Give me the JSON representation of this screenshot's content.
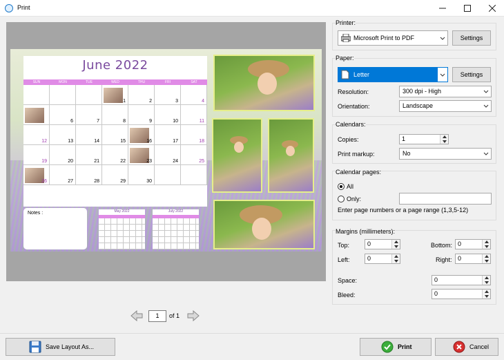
{
  "window": {
    "title": "Print"
  },
  "preview": {
    "calendar_title": "June 2022",
    "weekdays": [
      "SUN",
      "MON",
      "TUE",
      "WED",
      "THU",
      "FRI",
      "SAT"
    ],
    "day_numbers": [
      "1",
      "2",
      "3",
      "4",
      "6",
      "7",
      "8",
      "9",
      "10",
      "11",
      "12",
      "13",
      "14",
      "15",
      "16",
      "17",
      "18",
      "19",
      "20",
      "21",
      "22",
      "23",
      "24",
      "25",
      "26",
      "27",
      "28",
      "29",
      "30"
    ],
    "notes_label": "Notes :",
    "mini_left": "May 2022",
    "mini_right": "July 2022"
  },
  "pager": {
    "current": "1",
    "of_label": "of 1"
  },
  "printer": {
    "group_label": "Printer:",
    "selected": "Microsoft Print to PDF",
    "settings_label": "Settings"
  },
  "paper": {
    "group_label": "Paper:",
    "selected": "Letter",
    "settings_label": "Settings",
    "resolution_label": "Resolution:",
    "resolution_value": "300 dpi - High",
    "orientation_label": "Orientation:",
    "orientation_value": "Landscape"
  },
  "calendars": {
    "group_label": "Calendars:",
    "copies_label": "Copies:",
    "copies_value": "1",
    "markup_label": "Print markup:",
    "markup_value": "No"
  },
  "calendar_pages": {
    "group_label": "Calendar pages:",
    "all_label": "All",
    "only_label": "Only:",
    "only_value": "",
    "hint": "Enter page numbers or a page range (1,3,5-12)",
    "all_selected": true
  },
  "margins": {
    "group_label": "Margins (millimeters):",
    "top_label": "Top:",
    "top_value": "0",
    "bottom_label": "Bottom:",
    "bottom_value": "0",
    "left_label": "Left:",
    "left_value": "0",
    "right_label": "Right:",
    "right_value": "0",
    "space_label": "Space:",
    "space_value": "0",
    "bleed_label": "Bleed:",
    "bleed_value": "0"
  },
  "buttons": {
    "save_layout": "Save Layout As...",
    "print": "Print",
    "cancel": "Cancel"
  },
  "colors": {
    "accent": "#0078d7",
    "calendar_header": "#e08be6",
    "photo_border": "#e6ef8a"
  },
  "icons": [
    "app-icon",
    "minimize-icon",
    "maximize-icon",
    "close-icon",
    "printer-icon",
    "page-icon",
    "chevron-down-icon",
    "prev-arrow-icon",
    "next-arrow-icon",
    "save-disk-icon",
    "check-icon",
    "cancel-icon"
  ]
}
